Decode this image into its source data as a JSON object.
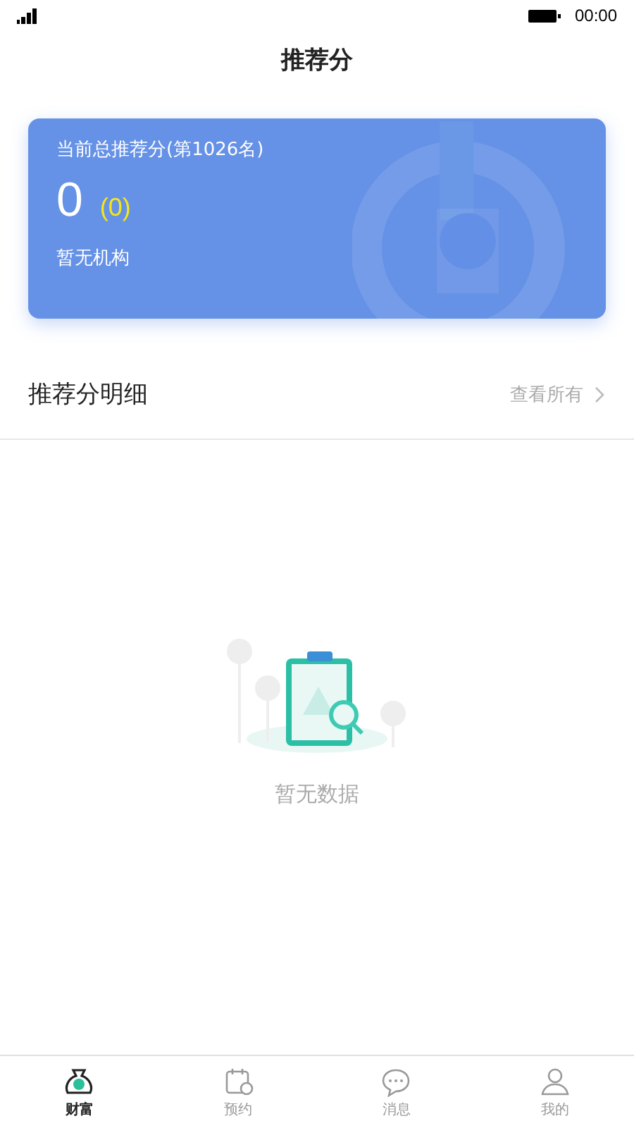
{
  "status_bar": {
    "time": "00:00"
  },
  "header": {
    "title": "推荐分"
  },
  "score_card": {
    "label": "当前总推荐分(第1026名)",
    "score": "0",
    "delta": "(0)",
    "institution": "暂无机构"
  },
  "detail_section": {
    "title": "推荐分明细",
    "link": "查看所有"
  },
  "empty_state": {
    "message": "暂无数据"
  },
  "tabs": [
    {
      "label": "财富",
      "kind": "wealth",
      "selected": true
    },
    {
      "label": "预约",
      "kind": "calendar",
      "selected": false
    },
    {
      "label": "消息",
      "kind": "message",
      "selected": false
    },
    {
      "label": "我的",
      "kind": "profile",
      "selected": false
    }
  ]
}
